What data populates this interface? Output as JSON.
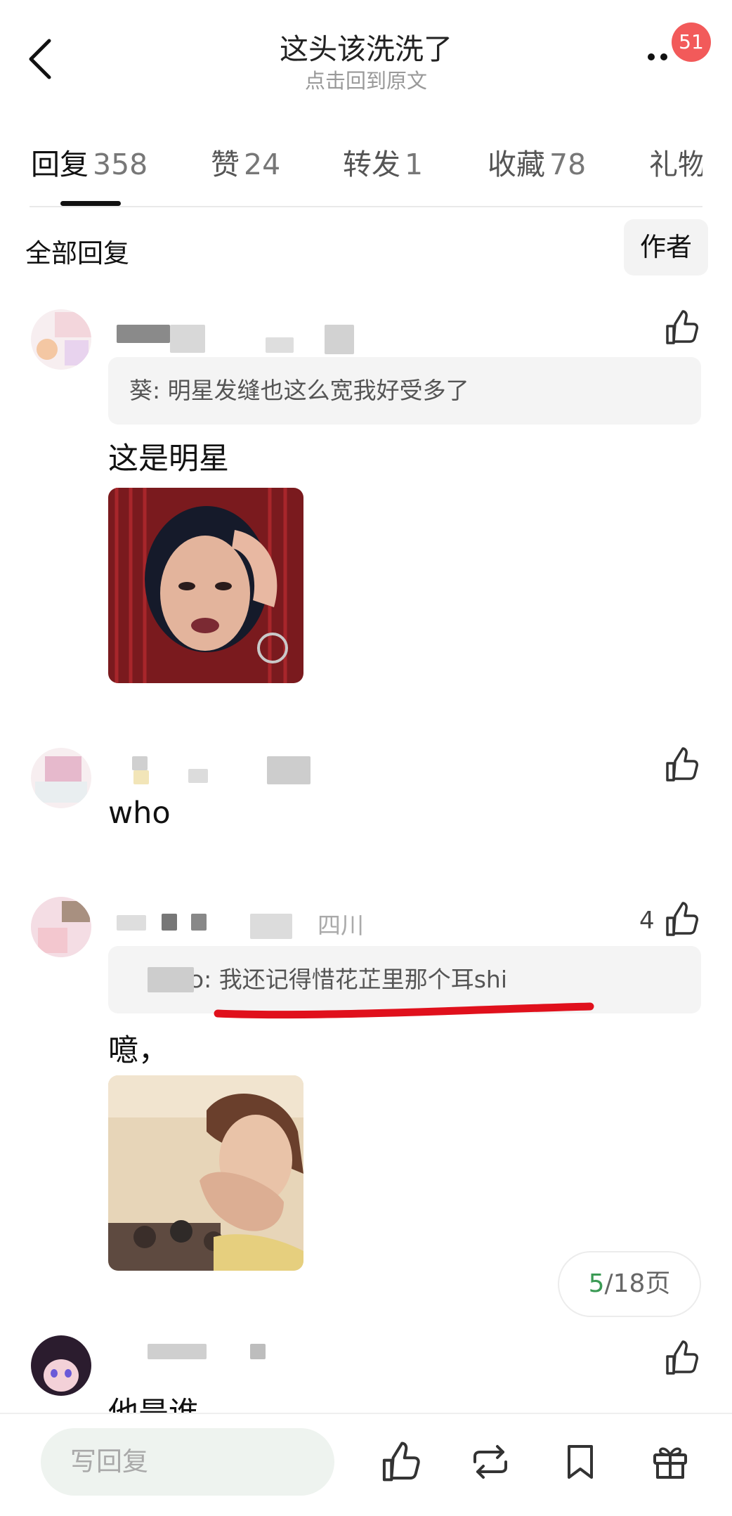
{
  "header": {
    "title": "这头该洗洗了",
    "subtitle": "点击回到原文",
    "notification_count": "51"
  },
  "tabs": [
    {
      "label": "回复",
      "count": "358",
      "active": true
    },
    {
      "label": "赞",
      "count": "24"
    },
    {
      "label": "转发",
      "count": "1"
    },
    {
      "label": "收藏",
      "count": "78"
    },
    {
      "label": "礼物",
      "count": ""
    }
  ],
  "filter": {
    "all_replies": "全部回复",
    "author_only": "作者"
  },
  "comments": [
    {
      "quote": "葵: 明星发缝也这么宽我好受多了",
      "text": "这是明星",
      "location": "",
      "likes": ""
    },
    {
      "quote": "",
      "text": "who",
      "location": "",
      "likes": ""
    },
    {
      "quote": "ɔ: 我还记得惜花芷里那个耳shi",
      "text": "噫，",
      "location": "四川",
      "likes": "4"
    },
    {
      "quote": "",
      "text": "他是谁",
      "location": "",
      "likes": ""
    }
  ],
  "pagination": {
    "current": "5",
    "total": "/18页"
  },
  "bottom_bar": {
    "reply_placeholder": "写回复",
    "icons": [
      "like-icon",
      "repost-icon",
      "bookmark-icon",
      "gift-icon"
    ]
  },
  "colors": {
    "badge": "#f25a5a",
    "underline_annotation": "#e0101c",
    "page_current": "#3a9a54"
  }
}
